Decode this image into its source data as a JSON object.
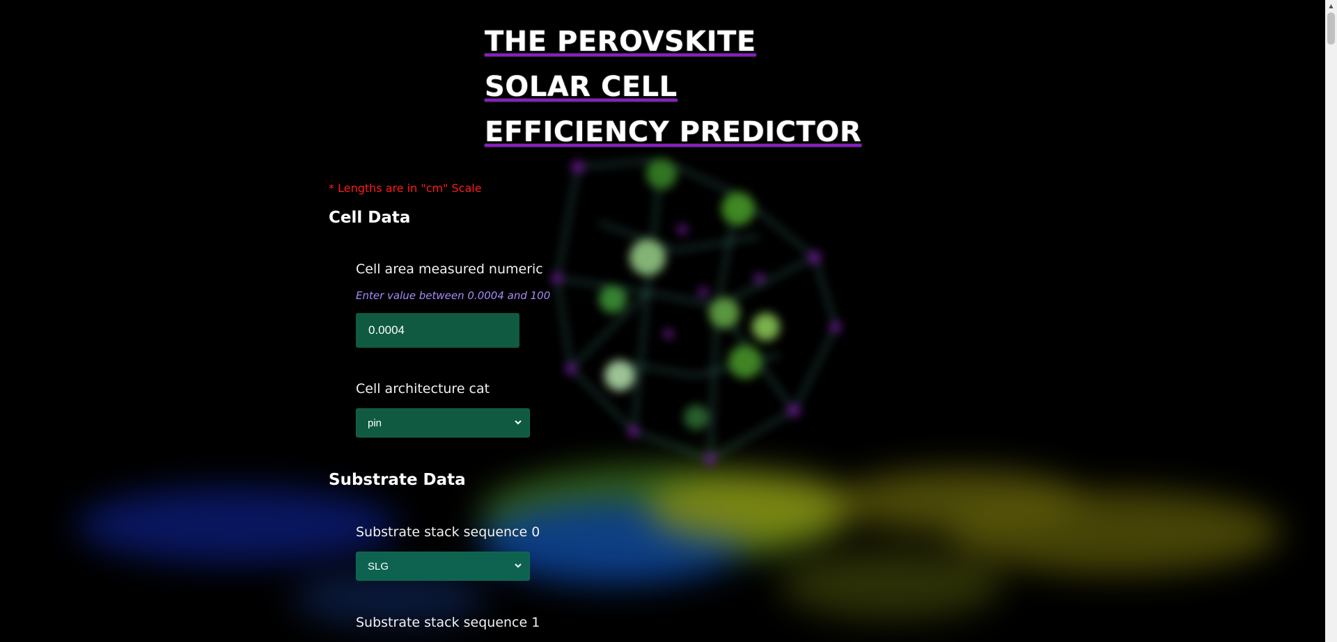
{
  "header": {
    "title_lines": [
      "THE PEROVSKITE",
      "SOLAR CELL",
      "EFFICIENCY PREDICTOR"
    ]
  },
  "note": "* Lengths are in \"cm\" Scale",
  "sections": {
    "cell": {
      "title": "Cell Data",
      "area_label": "Cell area measured numeric",
      "area_hint": "Enter value between 0.0004 and 100",
      "area_value": "0.0004",
      "architecture_label": "Cell architecture cat",
      "architecture_value": "pin"
    },
    "substrate": {
      "title": "Substrate Data",
      "stack0_label": "Substrate stack sequence 0",
      "stack0_value": "SLG",
      "stack1_label": "Substrate stack sequence 1"
    }
  },
  "colors": {
    "background": "#000000",
    "title_underline": "#8b1cc9",
    "note": "#ff1a1a",
    "hint": "#a78bfa",
    "field_bg": "#0f5a40"
  },
  "icons": {
    "select_chevron": "chevron-down-icon",
    "scroll_up": "triangle-up-icon"
  }
}
